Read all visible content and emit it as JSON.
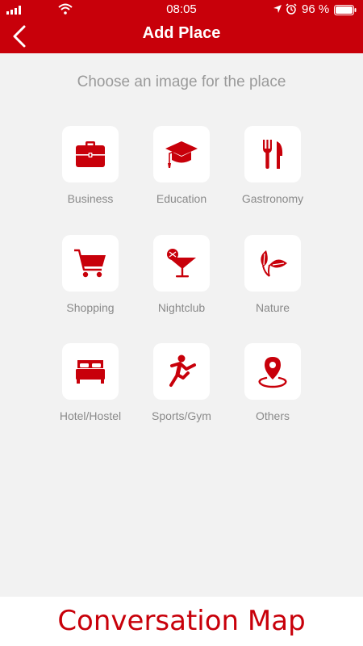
{
  "status_bar": {
    "time": "08:05",
    "battery_percent": "96 %",
    "icons": [
      "signal-icon",
      "wifi-icon",
      "location-arrow-icon",
      "alarm-icon",
      "battery-icon"
    ]
  },
  "header": {
    "title": "Add Place",
    "back_icon": "chevron-left-icon"
  },
  "subtitle": "Choose an image for the place",
  "categories": [
    {
      "label": "Business",
      "icon": "briefcase-icon"
    },
    {
      "label": "Education",
      "icon": "graduation-cap-icon"
    },
    {
      "label": "Gastronomy",
      "icon": "fork-knife-icon"
    },
    {
      "label": "Shopping",
      "icon": "shopping-cart-icon"
    },
    {
      "label": "Nightclub",
      "icon": "cocktail-icon"
    },
    {
      "label": "Nature",
      "icon": "leaf-icon"
    },
    {
      "label": "Hotel/Hostel",
      "icon": "bed-icon"
    },
    {
      "label": "Sports/Gym",
      "icon": "running-person-icon"
    },
    {
      "label": "Others",
      "icon": "map-pin-icon"
    }
  ],
  "footer": {
    "brand": "Conversation Map"
  },
  "colors": {
    "accent": "#c8000a",
    "background": "#f2f2f2",
    "label": "#8a8a8a"
  }
}
